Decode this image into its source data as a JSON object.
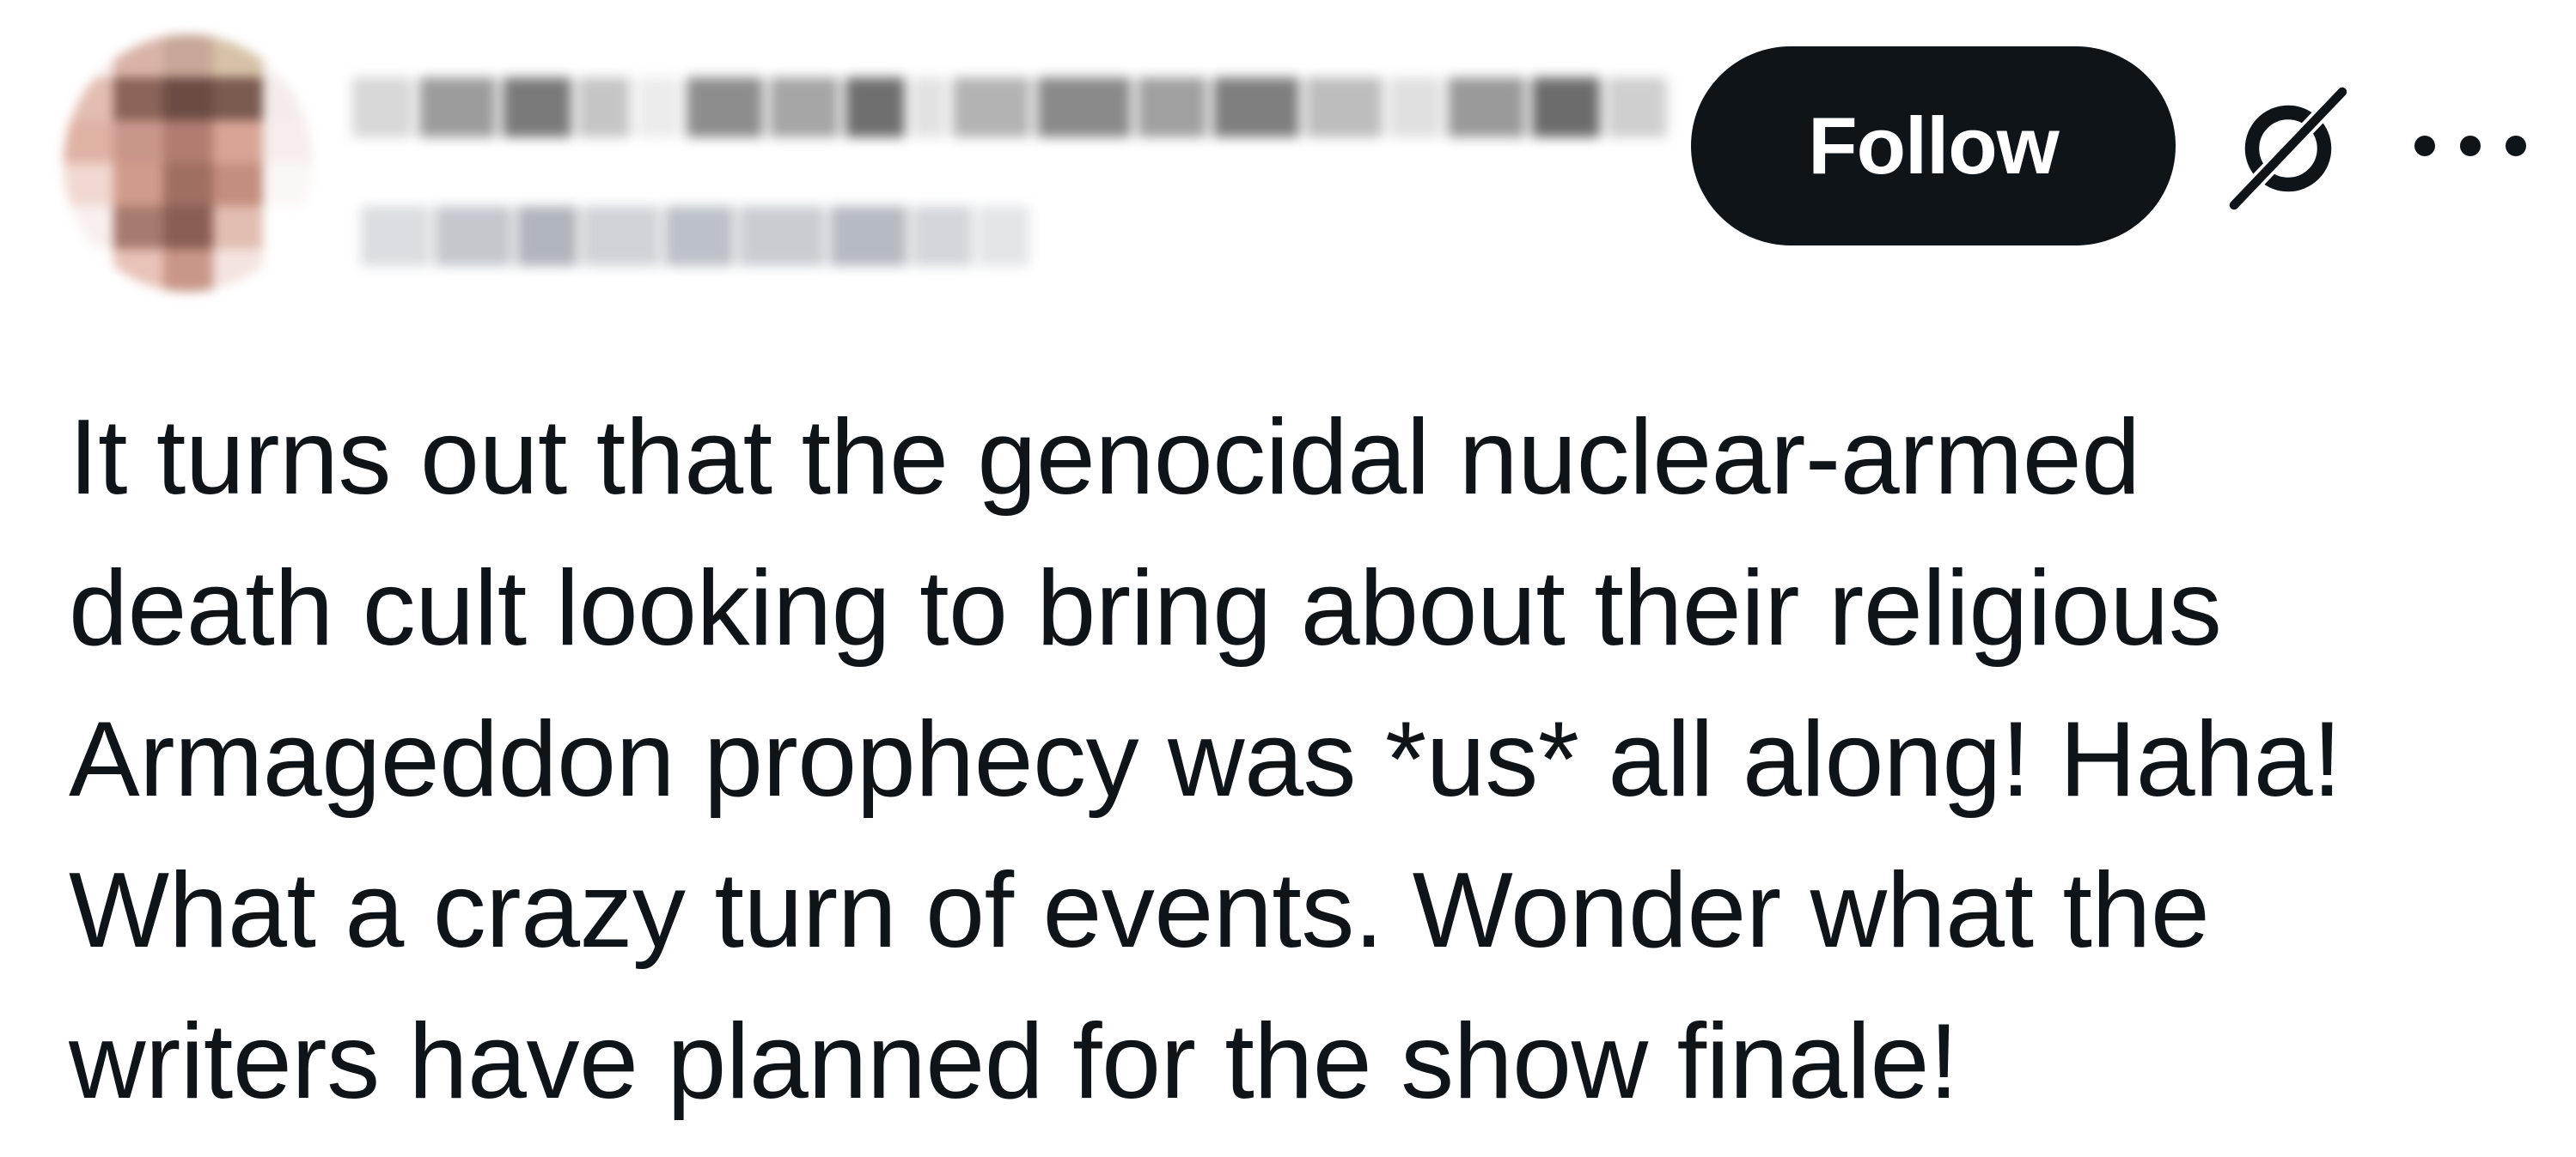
{
  "header": {
    "follow_label": "Follow",
    "more_icon": "more-horizontal-icon",
    "grok_icon": "grok-icon"
  },
  "tweet": {
    "lines": [
      "It turns out that the genocidal nuclear-armed",
      "death cult looking to bring about their religious",
      "Armageddon prophecy was *us* all along! Haha!",
      "What a crazy turn of events. Wonder what the",
      "writers have planned for the show finale!"
    ]
  },
  "colors": {
    "text": "#0f1419",
    "button_bg": "#0f1419",
    "button_text": "#ffffff",
    "background": "#ffffff"
  }
}
